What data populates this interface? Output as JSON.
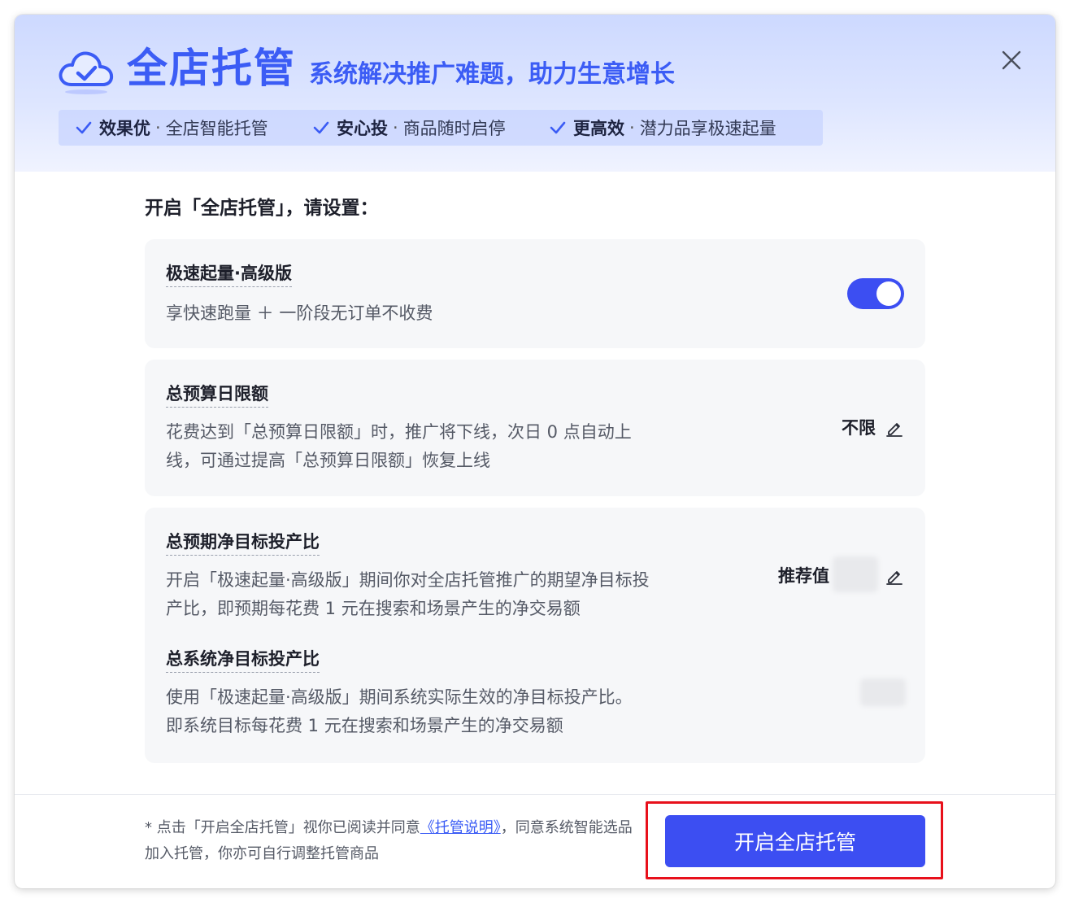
{
  "header": {
    "title": "全店托管",
    "subtitle": "系统解决推广难题，助力生意增长",
    "features": [
      {
        "bold": "效果优",
        "sep": "·",
        "text": "全店智能托管"
      },
      {
        "bold": "安心投",
        "sep": "·",
        "text": "商品随时启停"
      },
      {
        "bold": "更高效",
        "sep": "·",
        "text": "潜力品享极速起量"
      }
    ]
  },
  "main": {
    "section_title": "开启「全店托管」，请设置：",
    "cards": {
      "speed": {
        "title": "极速起量·高级版",
        "desc": "享快速跑量 ＋ 一阶段无订单不收费",
        "enabled": true
      },
      "budget": {
        "title": "总预算日限额",
        "desc": "花费达到「总预算日限额」时，推广将下线，次日 0 点自动上线，可通过提高「总预算日限额」恢复上线",
        "value": "不限"
      },
      "roi": {
        "title": "总预期净目标投产比",
        "desc": "开启「极速起量·高级版」期间你对全店托管推广的期望净目标投产比，即预期每花费 1 元在搜索和场景产生的净交易额",
        "value_label": "推荐值",
        "system_title": "总系统净目标投产比",
        "system_desc": "使用「极速起量·高级版」期间系统实际生效的净目标投产比。即系统目标每花费 1 元在搜索和场景产生的净交易额"
      }
    }
  },
  "footer": {
    "note_prefix": "* 点击「开启全店托管」视你已阅读并同意",
    "note_link": "《托管说明》",
    "note_suffix": "，同意系统智能选品加入托管，你亦可自行调整托管商品",
    "primary_button": "开启全店托管"
  },
  "colors": {
    "accent": "#3c4ef2",
    "brand_text": "#3b5cf5",
    "highlight": "#e8101b"
  }
}
